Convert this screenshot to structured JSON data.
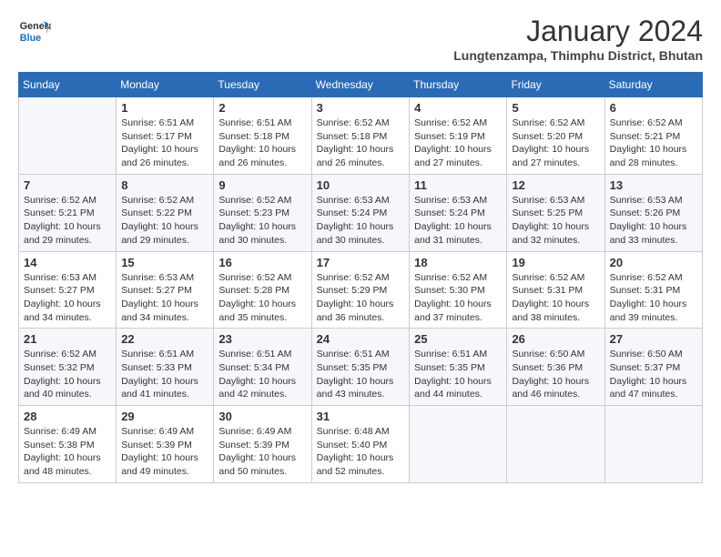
{
  "header": {
    "logo_line1": "General",
    "logo_line2": "Blue",
    "month": "January 2024",
    "location": "Lungtenzampa, Thimphu District, Bhutan"
  },
  "days_of_week": [
    "Sunday",
    "Monday",
    "Tuesday",
    "Wednesday",
    "Thursday",
    "Friday",
    "Saturday"
  ],
  "weeks": [
    [
      {
        "day": "",
        "info": ""
      },
      {
        "day": "1",
        "info": "Sunrise: 6:51 AM\nSunset: 5:17 PM\nDaylight: 10 hours\nand 26 minutes."
      },
      {
        "day": "2",
        "info": "Sunrise: 6:51 AM\nSunset: 5:18 PM\nDaylight: 10 hours\nand 26 minutes."
      },
      {
        "day": "3",
        "info": "Sunrise: 6:52 AM\nSunset: 5:18 PM\nDaylight: 10 hours\nand 26 minutes."
      },
      {
        "day": "4",
        "info": "Sunrise: 6:52 AM\nSunset: 5:19 PM\nDaylight: 10 hours\nand 27 minutes."
      },
      {
        "day": "5",
        "info": "Sunrise: 6:52 AM\nSunset: 5:20 PM\nDaylight: 10 hours\nand 27 minutes."
      },
      {
        "day": "6",
        "info": "Sunrise: 6:52 AM\nSunset: 5:21 PM\nDaylight: 10 hours\nand 28 minutes."
      }
    ],
    [
      {
        "day": "7",
        "info": "Sunrise: 6:52 AM\nSunset: 5:21 PM\nDaylight: 10 hours\nand 29 minutes."
      },
      {
        "day": "8",
        "info": "Sunrise: 6:52 AM\nSunset: 5:22 PM\nDaylight: 10 hours\nand 29 minutes."
      },
      {
        "day": "9",
        "info": "Sunrise: 6:52 AM\nSunset: 5:23 PM\nDaylight: 10 hours\nand 30 minutes."
      },
      {
        "day": "10",
        "info": "Sunrise: 6:53 AM\nSunset: 5:24 PM\nDaylight: 10 hours\nand 30 minutes."
      },
      {
        "day": "11",
        "info": "Sunrise: 6:53 AM\nSunset: 5:24 PM\nDaylight: 10 hours\nand 31 minutes."
      },
      {
        "day": "12",
        "info": "Sunrise: 6:53 AM\nSunset: 5:25 PM\nDaylight: 10 hours\nand 32 minutes."
      },
      {
        "day": "13",
        "info": "Sunrise: 6:53 AM\nSunset: 5:26 PM\nDaylight: 10 hours\nand 33 minutes."
      }
    ],
    [
      {
        "day": "14",
        "info": "Sunrise: 6:53 AM\nSunset: 5:27 PM\nDaylight: 10 hours\nand 34 minutes."
      },
      {
        "day": "15",
        "info": "Sunrise: 6:53 AM\nSunset: 5:27 PM\nDaylight: 10 hours\nand 34 minutes."
      },
      {
        "day": "16",
        "info": "Sunrise: 6:52 AM\nSunset: 5:28 PM\nDaylight: 10 hours\nand 35 minutes."
      },
      {
        "day": "17",
        "info": "Sunrise: 6:52 AM\nSunset: 5:29 PM\nDaylight: 10 hours\nand 36 minutes."
      },
      {
        "day": "18",
        "info": "Sunrise: 6:52 AM\nSunset: 5:30 PM\nDaylight: 10 hours\nand 37 minutes."
      },
      {
        "day": "19",
        "info": "Sunrise: 6:52 AM\nSunset: 5:31 PM\nDaylight: 10 hours\nand 38 minutes."
      },
      {
        "day": "20",
        "info": "Sunrise: 6:52 AM\nSunset: 5:31 PM\nDaylight: 10 hours\nand 39 minutes."
      }
    ],
    [
      {
        "day": "21",
        "info": "Sunrise: 6:52 AM\nSunset: 5:32 PM\nDaylight: 10 hours\nand 40 minutes."
      },
      {
        "day": "22",
        "info": "Sunrise: 6:51 AM\nSunset: 5:33 PM\nDaylight: 10 hours\nand 41 minutes."
      },
      {
        "day": "23",
        "info": "Sunrise: 6:51 AM\nSunset: 5:34 PM\nDaylight: 10 hours\nand 42 minutes."
      },
      {
        "day": "24",
        "info": "Sunrise: 6:51 AM\nSunset: 5:35 PM\nDaylight: 10 hours\nand 43 minutes."
      },
      {
        "day": "25",
        "info": "Sunrise: 6:51 AM\nSunset: 5:35 PM\nDaylight: 10 hours\nand 44 minutes."
      },
      {
        "day": "26",
        "info": "Sunrise: 6:50 AM\nSunset: 5:36 PM\nDaylight: 10 hours\nand 46 minutes."
      },
      {
        "day": "27",
        "info": "Sunrise: 6:50 AM\nSunset: 5:37 PM\nDaylight: 10 hours\nand 47 minutes."
      }
    ],
    [
      {
        "day": "28",
        "info": "Sunrise: 6:49 AM\nSunset: 5:38 PM\nDaylight: 10 hours\nand 48 minutes."
      },
      {
        "day": "29",
        "info": "Sunrise: 6:49 AM\nSunset: 5:39 PM\nDaylight: 10 hours\nand 49 minutes."
      },
      {
        "day": "30",
        "info": "Sunrise: 6:49 AM\nSunset: 5:39 PM\nDaylight: 10 hours\nand 50 minutes."
      },
      {
        "day": "31",
        "info": "Sunrise: 6:48 AM\nSunset: 5:40 PM\nDaylight: 10 hours\nand 52 minutes."
      },
      {
        "day": "",
        "info": ""
      },
      {
        "day": "",
        "info": ""
      },
      {
        "day": "",
        "info": ""
      }
    ]
  ]
}
